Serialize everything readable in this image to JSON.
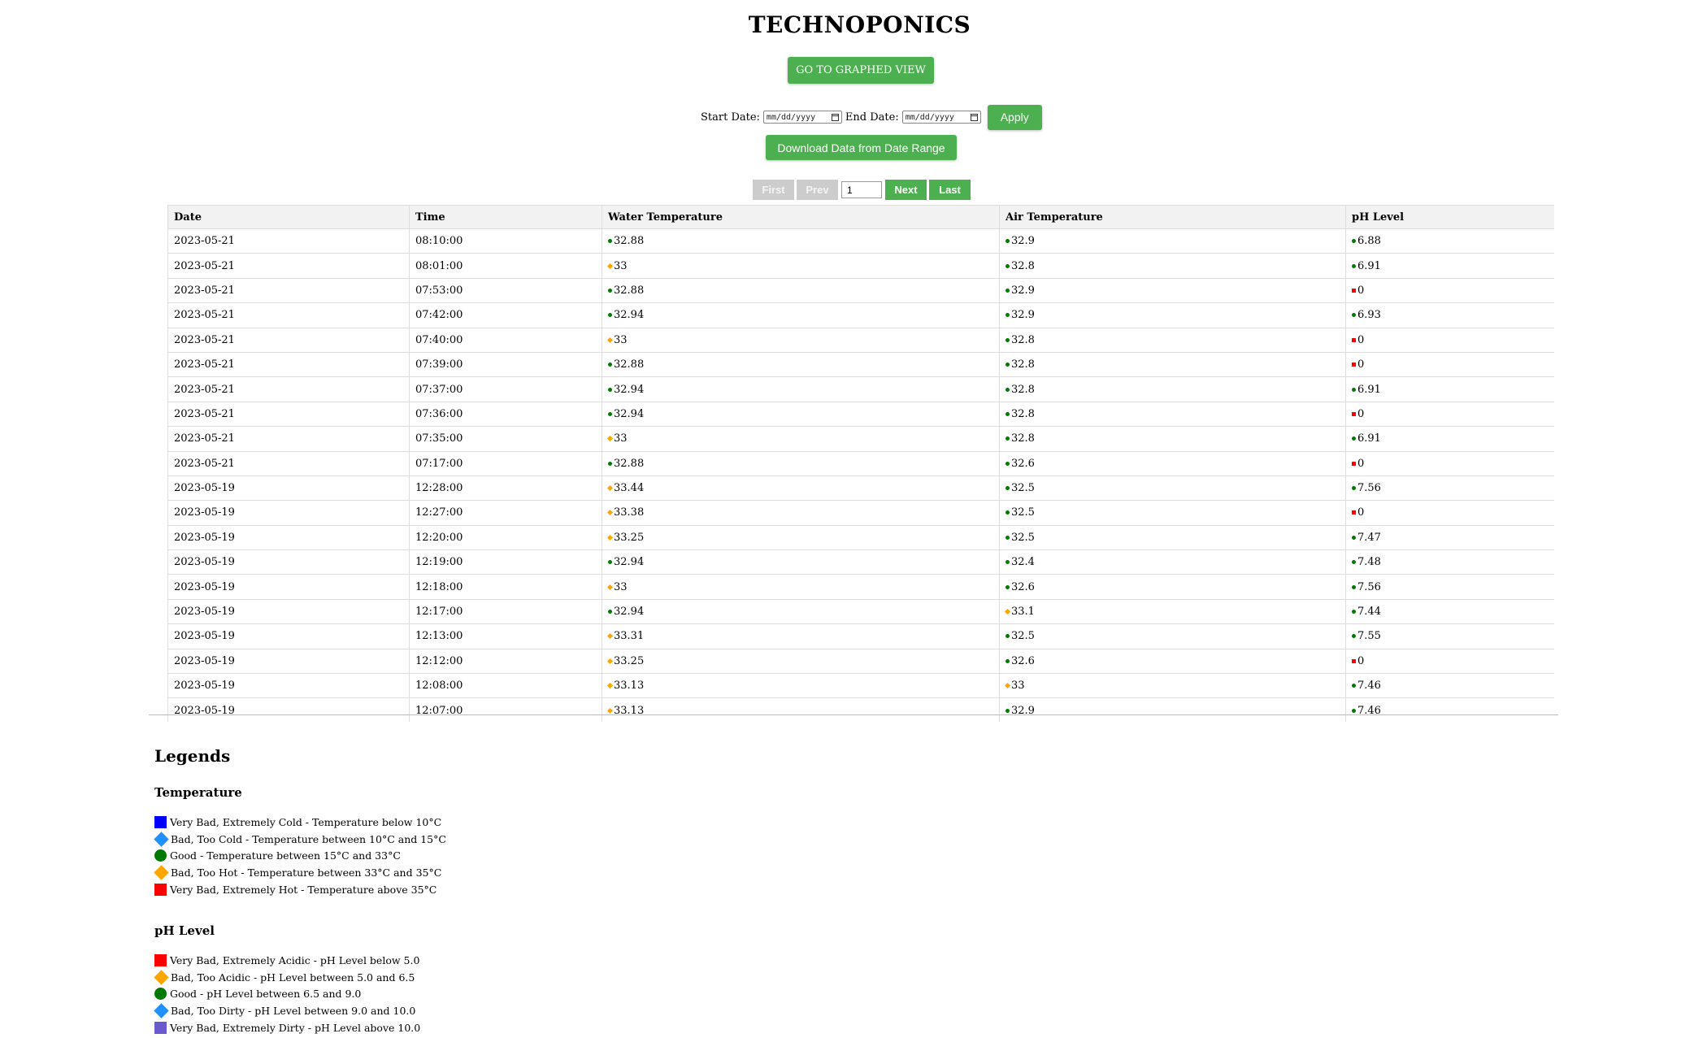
{
  "header": {
    "title": "TECHNOPONICS",
    "graph_button": "GO TO GRAPHED VIEW"
  },
  "filters": {
    "start_label": "Start Date:",
    "end_label": "End Date:",
    "date_placeholder": "mm/dd/yyyy",
    "apply_label": "Apply",
    "download_label": "Download Data from Date Range"
  },
  "pagination": {
    "first": "First",
    "prev": "Prev",
    "current_page": "1",
    "next": "Next",
    "last": "Last"
  },
  "colors": {
    "accent": "#4CAF50",
    "good": "#007a00",
    "warn": "#FFA500",
    "bad": "#ff0000",
    "cold": "#0000ff",
    "cool": "#1e90ff",
    "dirty": "#6a5acd"
  },
  "table": {
    "columns": [
      "Date",
      "Time",
      "Water Temperature",
      "Air Temperature",
      "pH Level"
    ],
    "rows": [
      {
        "date": "2023-05-21",
        "time": "08:10:00",
        "water": "32.88",
        "water_status": "good",
        "air": "32.9",
        "air_status": "good",
        "ph": "6.88",
        "ph_status": "good"
      },
      {
        "date": "2023-05-21",
        "time": "08:01:00",
        "water": "33",
        "water_status": "warn",
        "air": "32.8",
        "air_status": "good",
        "ph": "6.91",
        "ph_status": "good"
      },
      {
        "date": "2023-05-21",
        "time": "07:53:00",
        "water": "32.88",
        "water_status": "good",
        "air": "32.9",
        "air_status": "good",
        "ph": "0",
        "ph_status": "bad"
      },
      {
        "date": "2023-05-21",
        "time": "07:42:00",
        "water": "32.94",
        "water_status": "good",
        "air": "32.9",
        "air_status": "good",
        "ph": "6.93",
        "ph_status": "good"
      },
      {
        "date": "2023-05-21",
        "time": "07:40:00",
        "water": "33",
        "water_status": "warn",
        "air": "32.8",
        "air_status": "good",
        "ph": "0",
        "ph_status": "bad"
      },
      {
        "date": "2023-05-21",
        "time": "07:39:00",
        "water": "32.88",
        "water_status": "good",
        "air": "32.8",
        "air_status": "good",
        "ph": "0",
        "ph_status": "bad"
      },
      {
        "date": "2023-05-21",
        "time": "07:37:00",
        "water": "32.94",
        "water_status": "good",
        "air": "32.8",
        "air_status": "good",
        "ph": "6.91",
        "ph_status": "good"
      },
      {
        "date": "2023-05-21",
        "time": "07:36:00",
        "water": "32.94",
        "water_status": "good",
        "air": "32.8",
        "air_status": "good",
        "ph": "0",
        "ph_status": "bad"
      },
      {
        "date": "2023-05-21",
        "time": "07:35:00",
        "water": "33",
        "water_status": "warn",
        "air": "32.8",
        "air_status": "good",
        "ph": "6.91",
        "ph_status": "good"
      },
      {
        "date": "2023-05-21",
        "time": "07:17:00",
        "water": "32.88",
        "water_status": "good",
        "air": "32.6",
        "air_status": "good",
        "ph": "0",
        "ph_status": "bad"
      },
      {
        "date": "2023-05-19",
        "time": "12:28:00",
        "water": "33.44",
        "water_status": "warn",
        "air": "32.5",
        "air_status": "good",
        "ph": "7.56",
        "ph_status": "good"
      },
      {
        "date": "2023-05-19",
        "time": "12:27:00",
        "water": "33.38",
        "water_status": "warn",
        "air": "32.5",
        "air_status": "good",
        "ph": "0",
        "ph_status": "bad"
      },
      {
        "date": "2023-05-19",
        "time": "12:20:00",
        "water": "33.25",
        "water_status": "warn",
        "air": "32.5",
        "air_status": "good",
        "ph": "7.47",
        "ph_status": "good"
      },
      {
        "date": "2023-05-19",
        "time": "12:19:00",
        "water": "32.94",
        "water_status": "good",
        "air": "32.4",
        "air_status": "good",
        "ph": "7.48",
        "ph_status": "good"
      },
      {
        "date": "2023-05-19",
        "time": "12:18:00",
        "water": "33",
        "water_status": "warn",
        "air": "32.6",
        "air_status": "good",
        "ph": "7.56",
        "ph_status": "good"
      },
      {
        "date": "2023-05-19",
        "time": "12:17:00",
        "water": "32.94",
        "water_status": "good",
        "air": "33.1",
        "air_status": "warn",
        "ph": "7.44",
        "ph_status": "good"
      },
      {
        "date": "2023-05-19",
        "time": "12:13:00",
        "water": "33.31",
        "water_status": "warn",
        "air": "32.5",
        "air_status": "good",
        "ph": "7.55",
        "ph_status": "good"
      },
      {
        "date": "2023-05-19",
        "time": "12:12:00",
        "water": "33.25",
        "water_status": "warn",
        "air": "32.6",
        "air_status": "good",
        "ph": "0",
        "ph_status": "bad"
      },
      {
        "date": "2023-05-19",
        "time": "12:08:00",
        "water": "33.13",
        "water_status": "warn",
        "air": "33",
        "air_status": "warn",
        "ph": "7.46",
        "ph_status": "good"
      },
      {
        "date": "2023-05-19",
        "time": "12:07:00",
        "water": "33.13",
        "water_status": "warn",
        "air": "32.9",
        "air_status": "good",
        "ph": "7.46",
        "ph_status": "good"
      }
    ]
  },
  "legends": {
    "title": "Legends",
    "temperature": {
      "title": "Temperature",
      "items": [
        {
          "label": "Very Bad, Extremely Cold - Temperature below 10°C",
          "shape": "square",
          "color": "#0000ff"
        },
        {
          "label": "Bad, Too Cold - Temperature between 10°C and 15°C",
          "shape": "diamond",
          "color": "#1e90ff"
        },
        {
          "label": "Good - Temperature between 15°C and 33°C",
          "shape": "circle",
          "color": "#007a00"
        },
        {
          "label": "Bad, Too Hot - Temperature between 33°C and 35°C",
          "shape": "diamond",
          "color": "#FFA500"
        },
        {
          "label": "Very Bad, Extremely Hot - Temperature above 35°C",
          "shape": "square",
          "color": "#ff0000"
        }
      ]
    },
    "ph": {
      "title": "pH Level",
      "items": [
        {
          "label": "Very Bad, Extremely Acidic - pH Level below 5.0",
          "shape": "square",
          "color": "#ff0000"
        },
        {
          "label": "Bad, Too Acidic - pH Level between 5.0 and 6.5",
          "shape": "diamond",
          "color": "#FFA500"
        },
        {
          "label": "Good - pH Level between 6.5 and 9.0",
          "shape": "circle",
          "color": "#007a00"
        },
        {
          "label": "Bad, Too Dirty - pH Level between 9.0 and 10.0",
          "shape": "diamond",
          "color": "#1e90ff"
        },
        {
          "label": "Very Bad, Extremely Dirty - pH Level above 10.0",
          "shape": "square",
          "color": "#6a5acd"
        }
      ]
    }
  }
}
